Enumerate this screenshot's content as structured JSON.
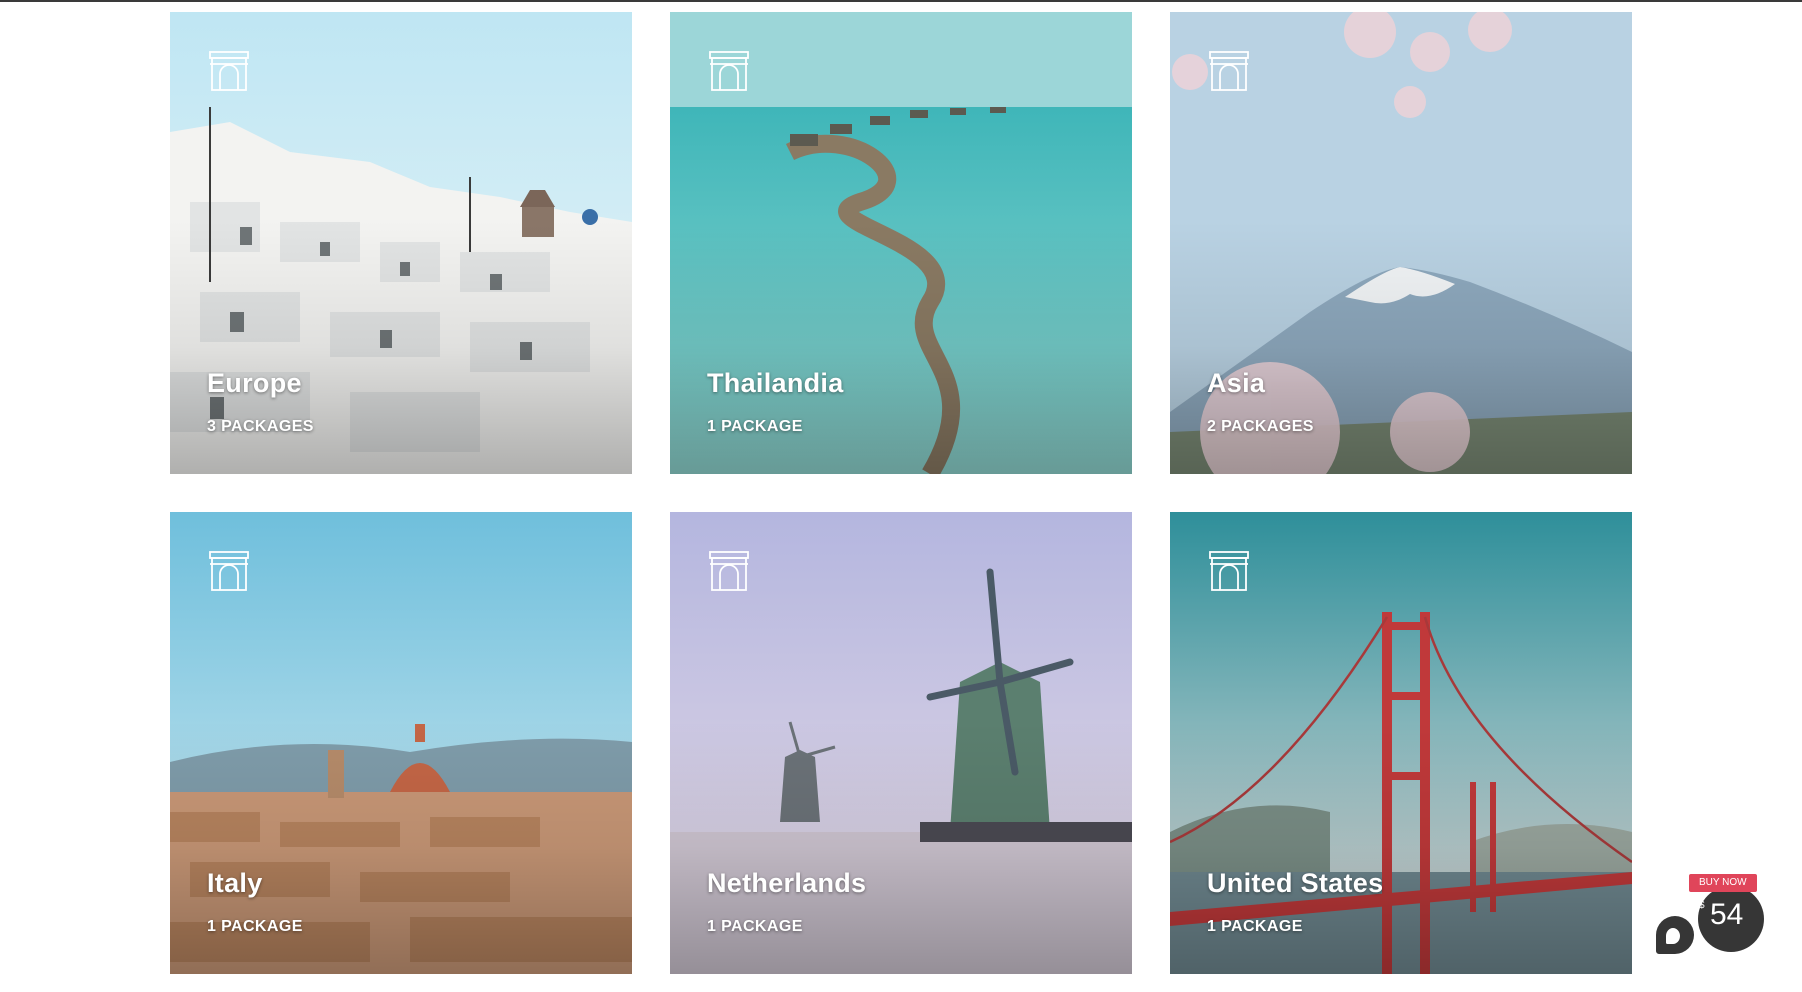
{
  "destinations": [
    {
      "name": "Europe",
      "packages": "3 PACKAGES",
      "icon": "arch-monument-icon"
    },
    {
      "name": "Thailandia",
      "packages": "1 PACKAGE",
      "icon": "arch-monument-icon"
    },
    {
      "name": "Asia",
      "packages": "2 PACKAGES",
      "icon": "arch-monument-icon"
    },
    {
      "name": "Italy",
      "packages": "1 PACKAGE",
      "icon": "arch-monument-icon"
    },
    {
      "name": "Netherlands",
      "packages": "1 PACKAGE",
      "icon": "arch-monument-icon"
    },
    {
      "name": "United States",
      "packages": "1 PACKAGE",
      "icon": "arch-monument-icon"
    }
  ],
  "buy_widget": {
    "label": "BUY NOW",
    "currency": "$",
    "price": "54",
    "color": "#e0455a"
  }
}
